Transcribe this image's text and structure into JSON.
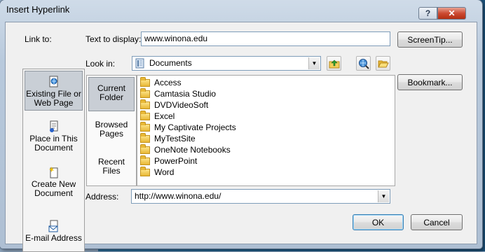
{
  "window": {
    "title": "Insert Hyperlink",
    "help_glyph": "?",
    "close_glyph": "✕"
  },
  "link_to": {
    "label": "Link to:",
    "items": [
      {
        "label": "Existing File or Web Page",
        "icon": "globe-page-icon",
        "selected": true
      },
      {
        "label": "Place in This Document",
        "icon": "document-place-icon",
        "selected": false
      },
      {
        "label": "Create New Document",
        "icon": "new-document-icon",
        "selected": false
      },
      {
        "label": "E-mail Address",
        "icon": "email-icon",
        "selected": false
      }
    ]
  },
  "text_to_display": {
    "label": "Text to display:",
    "value": "www.winona.edu"
  },
  "screentip_button": "ScreenTip...",
  "look_in": {
    "label": "Look in:",
    "value": "Documents",
    "icon": "documents-library-icon"
  },
  "toolbar": {
    "up_folder": "up-folder-icon",
    "browse_web": "browse-web-icon",
    "browse_file": "open-folder-icon"
  },
  "bookmark_button": "Bookmark...",
  "nav_tabs": [
    {
      "label": "Current Folder",
      "selected": true
    },
    {
      "label": "Browsed Pages",
      "selected": false
    },
    {
      "label": "Recent Files",
      "selected": false
    }
  ],
  "files": [
    "Access",
    "Camtasia Studio",
    "DVDVideoSoft",
    "Excel",
    "My Captivate Projects",
    "MyTestSite",
    "OneNote Notebooks",
    "PowerPoint",
    "Word"
  ],
  "address": {
    "label": "Address:",
    "value": "http://www.winona.edu/"
  },
  "ok_button": "OK",
  "cancel_button": "Cancel",
  "colors": {
    "frame": "#b8c9dc",
    "client": "#f0f0f0",
    "close": "#cc4b33",
    "selection": "#c9cfd6"
  }
}
